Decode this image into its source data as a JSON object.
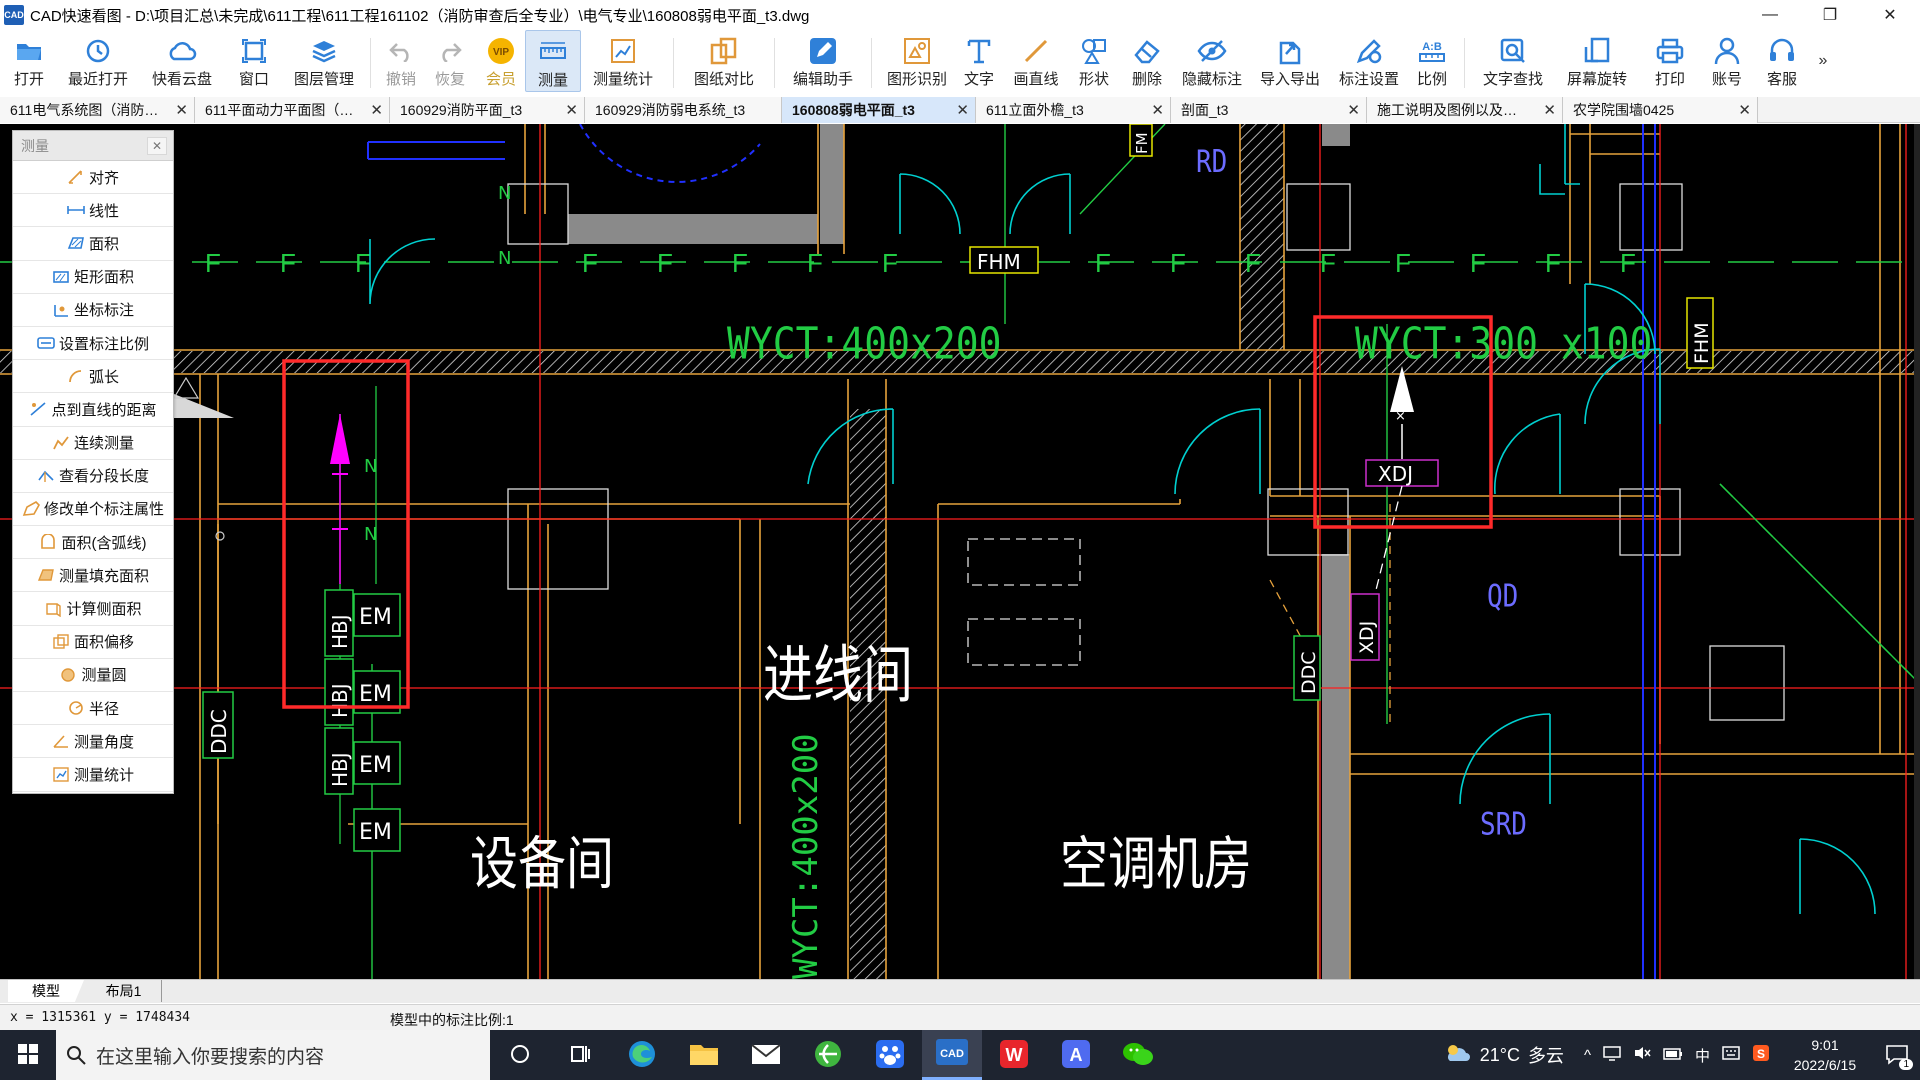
{
  "window": {
    "title": "CAD快速看图 - D:\\项目汇总\\未完成\\611工程\\611工程161102（消防审查后全专业）\\电气专业\\160808弱电平面_t3.dwg",
    "app_icon_text": "CAD",
    "controls": {
      "minimize": "—",
      "restore": "❐",
      "close": "✕"
    }
  },
  "toolbar": {
    "items": [
      {
        "label": "打开",
        "icon": "folder-open-icon"
      },
      {
        "label": "最近打开",
        "icon": "clock-icon"
      },
      {
        "label": "快看云盘",
        "icon": "cloud-icon"
      },
      {
        "label": "窗口",
        "icon": "window-icon"
      },
      {
        "label": "图层管理",
        "icon": "layers-icon"
      },
      {
        "label": "撤销",
        "icon": "undo-icon"
      },
      {
        "label": "恢复",
        "icon": "redo-icon"
      },
      {
        "label": "会员",
        "icon": "vip-icon",
        "badge": "VIP"
      },
      {
        "label": "测量",
        "icon": "ruler-icon"
      },
      {
        "label": "测量统计",
        "icon": "measure-stats-icon"
      },
      {
        "label": "图纸对比",
        "icon": "compare-icon"
      },
      {
        "label": "编辑助手",
        "icon": "edit-assistant-icon"
      },
      {
        "label": "图形识别",
        "icon": "shape-recognize-icon"
      },
      {
        "label": "文字",
        "icon": "text-icon"
      },
      {
        "label": "画直线",
        "icon": "line-icon"
      },
      {
        "label": "形状",
        "icon": "shapes-icon"
      },
      {
        "label": "删除",
        "icon": "eraser-icon"
      },
      {
        "label": "隐藏标注",
        "icon": "eye-hide-icon"
      },
      {
        "label": "导入导出",
        "icon": "import-export-icon"
      },
      {
        "label": "标注设置",
        "icon": "annotation-settings-icon"
      },
      {
        "label": "比例",
        "icon": "scale-icon",
        "badge": "A:B"
      },
      {
        "label": "文字查找",
        "icon": "text-search-icon"
      },
      {
        "label": "屏幕旋转",
        "icon": "rotate-screen-icon"
      },
      {
        "label": "打印",
        "icon": "printer-icon"
      },
      {
        "label": "账号",
        "icon": "user-icon"
      },
      {
        "label": "客服",
        "icon": "headset-icon"
      }
    ],
    "overflow": "»"
  },
  "tabs": [
    {
      "label": "611电气系统图（消防…",
      "close": "✕"
    },
    {
      "label": "611平面动力平面图（…",
      "close": "✕"
    },
    {
      "label": "160929消防平面_t3",
      "close": "✕"
    },
    {
      "label": "160929消防弱电系统_t3",
      "close": ""
    },
    {
      "label": "160808弱电平面_t3",
      "close": "✕"
    },
    {
      "label": "611立面外檐_t3",
      "close": "✕"
    },
    {
      "label": "剖面_t3",
      "close": "✕"
    },
    {
      "label": "施工说明及图例以及…",
      "close": "✕"
    },
    {
      "label": "农学院围墙0425",
      "close": "✕"
    }
  ],
  "measure_panel": {
    "title": "测量",
    "close": "✕",
    "items": [
      {
        "label": "对齐",
        "icon": "align-measure-icon"
      },
      {
        "label": "线性",
        "icon": "linear-measure-icon"
      },
      {
        "label": "面积",
        "icon": "area-icon"
      },
      {
        "label": "矩形面积",
        "icon": "rect-area-icon"
      },
      {
        "label": "坐标标注",
        "icon": "coordinate-icon"
      },
      {
        "label": "设置标注比例",
        "icon": "set-scale-icon"
      },
      {
        "label": "弧长",
        "icon": "arc-length-icon"
      },
      {
        "label": "点到直线的距离",
        "icon": "point-line-distance-icon"
      },
      {
        "label": "连续测量",
        "icon": "continuous-measure-icon"
      },
      {
        "label": "查看分段长度",
        "icon": "segment-length-icon"
      },
      {
        "label": "修改单个标注属性",
        "icon": "edit-annotation-icon"
      },
      {
        "label": "面积(含弧线)",
        "icon": "arc-area-icon"
      },
      {
        "label": "测量填充面积",
        "icon": "hatch-area-icon"
      },
      {
        "label": "计算侧面积",
        "icon": "side-area-icon"
      },
      {
        "label": "面积偏移",
        "icon": "area-offset-icon"
      },
      {
        "label": "测量圆",
        "icon": "circle-measure-icon"
      },
      {
        "label": "半径",
        "icon": "radius-icon"
      },
      {
        "label": "测量角度",
        "icon": "angle-icon"
      },
      {
        "label": "测量统计",
        "icon": "stats-icon"
      }
    ]
  },
  "drawing": {
    "texts": {
      "wyct_left": "WYCT:400x200",
      "wyct_right": "WYCT:300 x100",
      "wyct_vertical": "WYCT:400x200",
      "fhm_center": "FHM",
      "fhm_right": "FHM",
      "fm_top": "FM",
      "rd": "RD",
      "qd": "QD",
      "srd": "SRD",
      "xdj_box": "XDJ",
      "xdj_vertical": "XDJ",
      "ddc_left": "DDC",
      "ddc_mid": "DDC",
      "hbj_1": "HBJ",
      "hbj_2": "HBJ",
      "hbj_3": "HBJ",
      "em_1": "EM",
      "em_2": "EM",
      "em_3": "EM",
      "em_4": "EM",
      "room_entry": "进线间",
      "room_equipment": "设备间",
      "room_hvac": "空调机房",
      "fire_mark": "F",
      "tick_mark": "N"
    },
    "colors": {
      "background": "#000000",
      "wall": "#e6a23c",
      "fire_line": "#22cc44",
      "door": "#00d0d0",
      "highlight": "#ff2a2a",
      "magenta": "#ff00ff",
      "blue_line": "#2030ff",
      "red_axis": "#ff1f1f",
      "room_text": "#ffffff",
      "tag_text": "#8080ff",
      "hatch": "#d8d8d8"
    }
  },
  "layout_tabs": [
    {
      "label": "模型",
      "active": true
    },
    {
      "label": "布局1",
      "active": false
    }
  ],
  "status": {
    "coords": "x = 1315361  y = 1748434",
    "scale": "模型中的标注比例:1"
  },
  "taskbar": {
    "search_placeholder": "在这里输入你要搜索的内容",
    "apps": [
      {
        "name": "task-view",
        "icon": "task-view-icon"
      },
      {
        "name": "multitask",
        "icon": "multitask-icon"
      },
      {
        "name": "edge",
        "icon": "edge-icon"
      },
      {
        "name": "explorer",
        "icon": "folder-icon"
      },
      {
        "name": "mail",
        "icon": "mail-icon"
      },
      {
        "name": "browser-360",
        "icon": "browser-icon"
      },
      {
        "name": "baidu",
        "icon": "paw-icon"
      },
      {
        "name": "cad",
        "icon": "cad-icon",
        "label": "CAD"
      },
      {
        "name": "wps",
        "icon": "wps-icon",
        "label": "W"
      },
      {
        "name": "text-app",
        "icon": "text-app-icon",
        "label": "A"
      },
      {
        "name": "wechat",
        "icon": "wechat-icon"
      }
    ],
    "weather": {
      "temp": "21°C",
      "desc": "多云"
    },
    "tray_chevron": "^",
    "ime": "中",
    "clock": {
      "time": "9:01",
      "date": "2022/6/15"
    },
    "notification_count": "1"
  }
}
